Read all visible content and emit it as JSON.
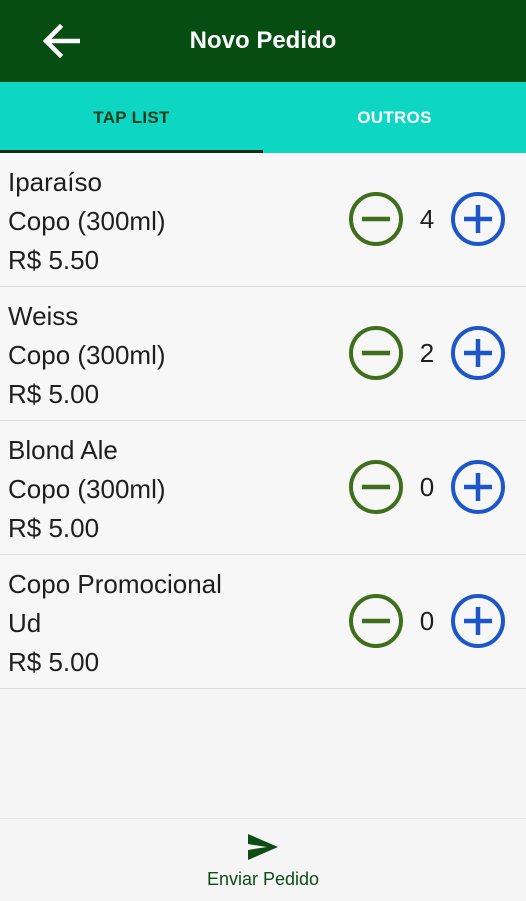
{
  "header": {
    "title": "Novo Pedido",
    "back_icon": "arrow-left-icon"
  },
  "tabs": [
    {
      "label": "TAP LIST",
      "active": true
    },
    {
      "label": "OUTROS",
      "active": false
    }
  ],
  "items": [
    {
      "name": "Iparaíso",
      "size": "Copo (300ml)",
      "price": "R$ 5.50",
      "qty": "4"
    },
    {
      "name": "Weiss",
      "size": "Copo (300ml)",
      "price": "R$ 5.00",
      "qty": "2"
    },
    {
      "name": "Blond Ale",
      "size": "Copo (300ml)",
      "price": "R$ 5.00",
      "qty": "0"
    },
    {
      "name": "Copo Promocional",
      "size": "Ud",
      "price": "R$ 5.00",
      "qty": "0"
    }
  ],
  "footer": {
    "send_label": "Enviar Pedido",
    "send_icon": "send-icon"
  },
  "colors": {
    "appbar": "#054d11",
    "tabs": "#0dd6c3",
    "minus": "#3f6e1c",
    "plus": "#1d56c8"
  }
}
